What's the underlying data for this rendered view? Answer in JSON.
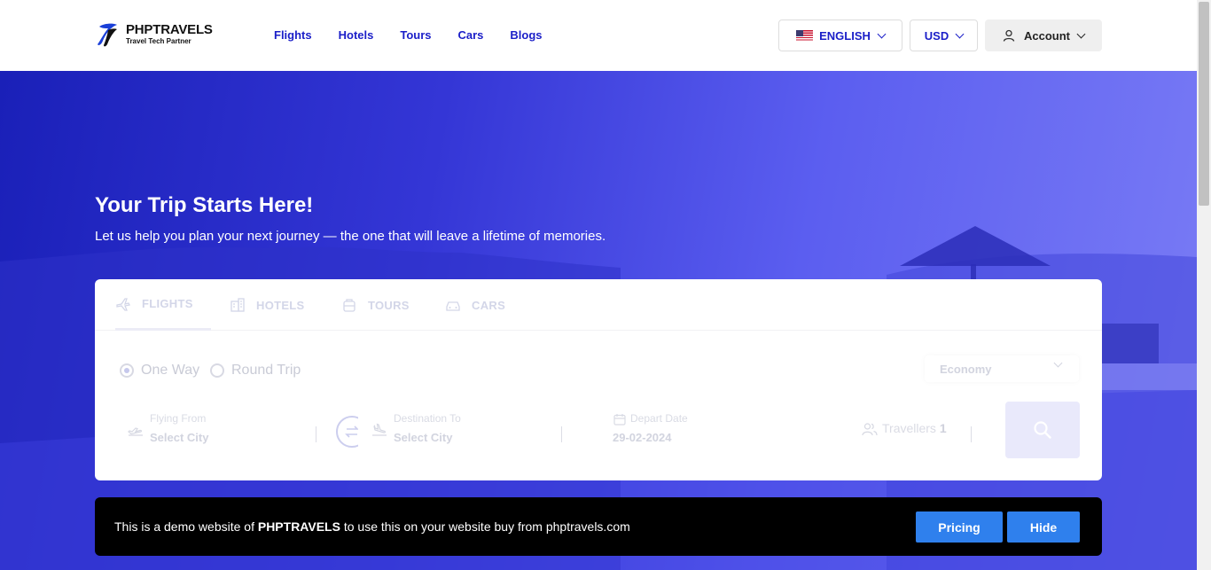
{
  "header": {
    "logo_title": "PHPTRAVELS",
    "logo_subtitle": "Travel Tech Partner",
    "nav": [
      "Flights",
      "Hotels",
      "Tours",
      "Cars",
      "Blogs"
    ],
    "language": "ENGLISH",
    "currency": "USD",
    "account": "Account"
  },
  "hero": {
    "title": "Your Trip Starts Here!",
    "subtitle": "Let us help you plan your next journey — the one that will leave a lifetime of memories."
  },
  "search": {
    "tabs": [
      "FLIGHTS",
      "HOTELS",
      "TOURS",
      "CARS"
    ],
    "active_tab": "FLIGHTS",
    "trip_types": [
      "One Way",
      "Round Trip"
    ],
    "selected_trip_type": "One Way",
    "cabin_class": "Economy",
    "from_label": "Flying From",
    "from_value": "Select City",
    "to_label": "Destination To",
    "to_value": "Select City",
    "date_label": "Depart Date",
    "date_value": "29-02-2024",
    "travellers_label": "Travellers",
    "travellers_count": "1"
  },
  "demo_bar": {
    "text_before": "This is a demo website of ",
    "brand": "PHPTRAVELS",
    "text_after": " to use this on your website buy from phptravels.com",
    "pricing_label": "Pricing",
    "hide_label": "Hide"
  },
  "colors": {
    "primary": "#1a1ec8",
    "button_blue": "#2f80ed",
    "hero_start": "#1a20b8",
    "hero_end": "#7a7cf5"
  }
}
